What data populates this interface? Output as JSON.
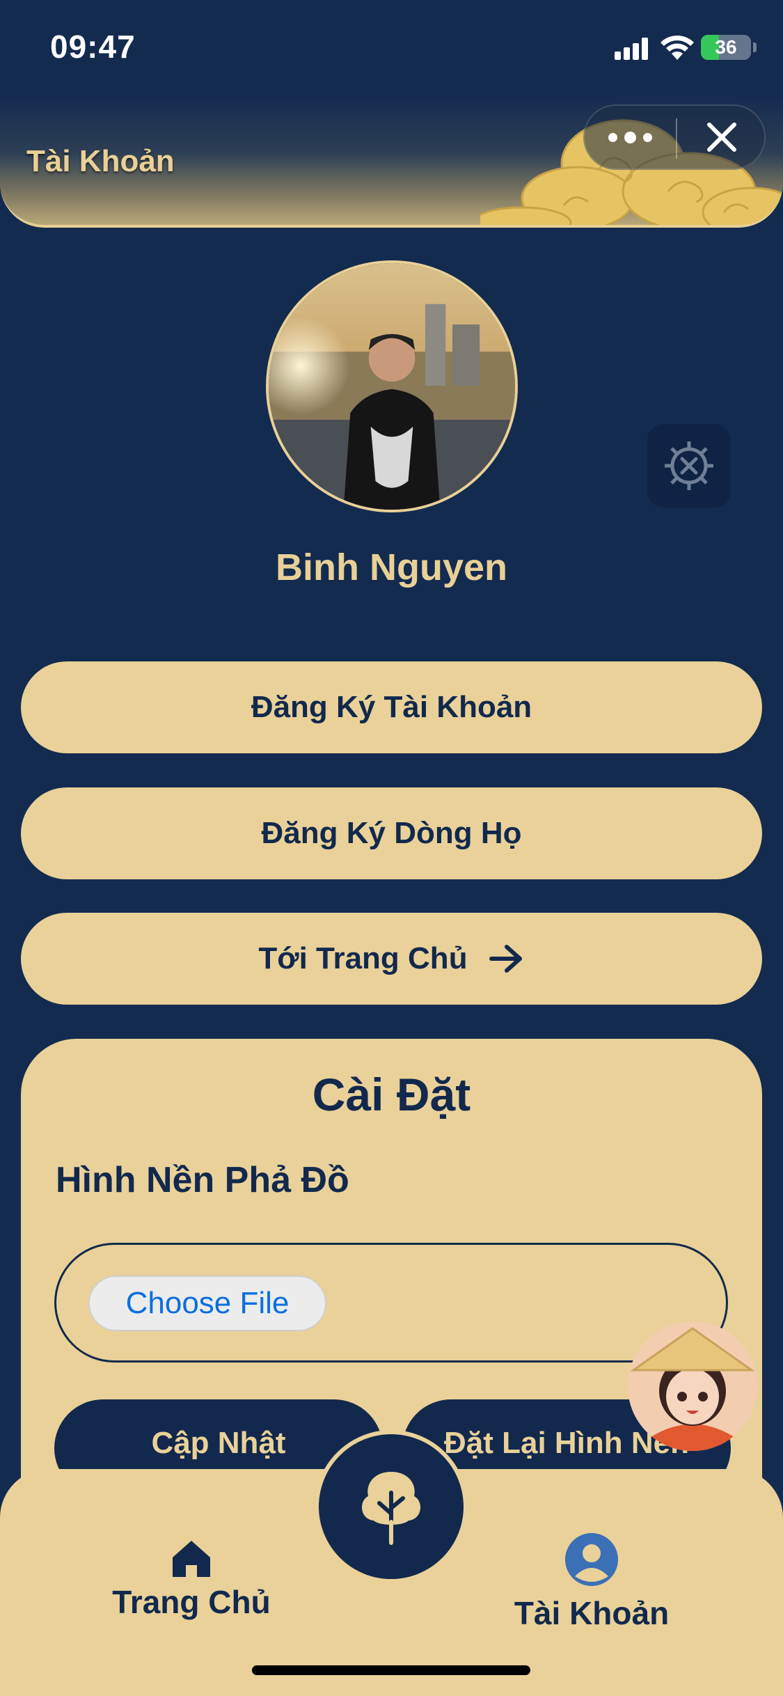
{
  "status_bar": {
    "time": "09:47",
    "battery": "36"
  },
  "header": {
    "title": "Tài Khoản"
  },
  "profile": {
    "name": "Binh Nguyen"
  },
  "actions": {
    "register_account": "Đăng Ký Tài Khoản",
    "register_family": "Đăng Ký Dòng Họ",
    "go_home": "Tới Trang Chủ"
  },
  "settings": {
    "title": "Cài Đặt",
    "background_heading": "Hình Nền Phả Đồ",
    "choose_file": "Choose File",
    "update": "Cập Nhật",
    "reset": "Đặt Lại Hình Nền"
  },
  "nav": {
    "home": "Trang Chủ",
    "account": "Tài Khoản"
  },
  "colors": {
    "background": "#132b4f",
    "accent": "#e9d199",
    "text_dark": "#12294d"
  }
}
